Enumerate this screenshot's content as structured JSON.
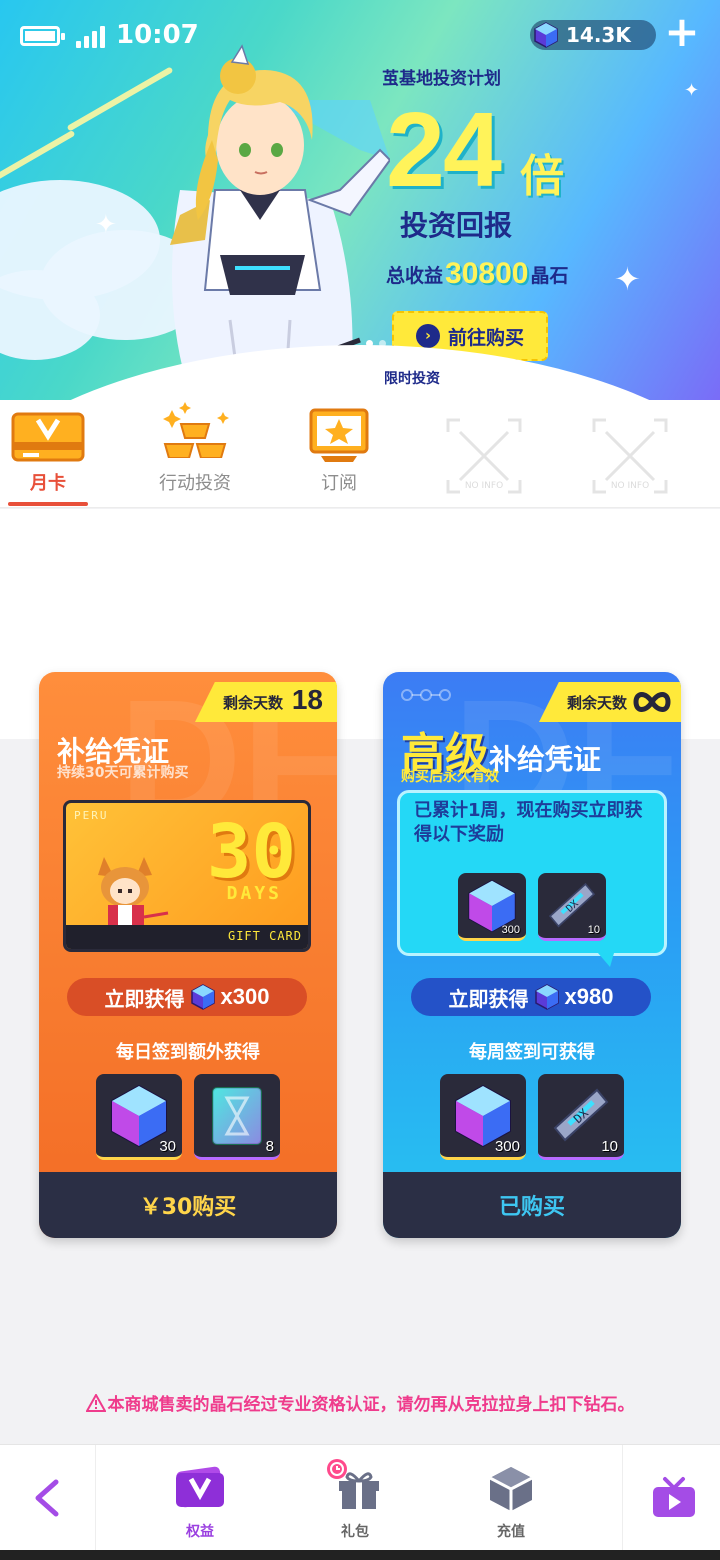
{
  "status": {
    "time": "10:07",
    "gem_amount": "14.3K"
  },
  "promo": {
    "title": "茧基地投资计划",
    "multiplier": "24",
    "multiplier_unit": "倍",
    "subtitle": "投资回报",
    "total_prefix": "总收益",
    "total_value": "30800",
    "total_suffix": "晶石",
    "buy_label": "前往购买",
    "limited_label": "限时投资"
  },
  "tabs": [
    {
      "label": "月卡",
      "active": true
    },
    {
      "label": "行动投资",
      "active": false
    },
    {
      "label": "订阅",
      "active": false
    },
    {
      "label": "NO INFO",
      "active": false
    },
    {
      "label": "NO INFO",
      "active": false
    }
  ],
  "cards": {
    "basic": {
      "tag_label": "剩余天数",
      "tag_value": "18",
      "title": "补给凭证",
      "subtitle": "持续30天可累计购买",
      "giftcard_peru": "PERU",
      "giftcard_days": "30",
      "giftcard_days_label": "DAYS",
      "giftcard_footer": "GIFT CARD",
      "get_now_label": "立即获得",
      "get_now_amount": "x300",
      "daily_label": "每日签到额外获得",
      "items": [
        {
          "icon": "crystal-cube",
          "count": "30"
        },
        {
          "icon": "hourglass-card",
          "count": "8"
        }
      ],
      "footer": "￥30购买"
    },
    "premium": {
      "tag_label": "剩余天数",
      "tag_value": "∞",
      "title_highlight": "高级",
      "title_rest": "补给凭证",
      "subtitle": "购买后永久有效",
      "bubble_text": "已累计1周，现在购买立即获得以下奖励",
      "bubble_items": [
        {
          "icon": "crystal-cube",
          "count": "300"
        },
        {
          "icon": "dx-ticket",
          "count": "10"
        }
      ],
      "get_now_label": "立即获得",
      "get_now_amount": "x980",
      "weekly_label": "每周签到可获得",
      "items": [
        {
          "icon": "crystal-cube",
          "count": "300"
        },
        {
          "icon": "dx-ticket",
          "count": "10"
        }
      ],
      "footer": "已购买"
    }
  },
  "warning": "本商城售卖的晶石经过专业资格认证，请勿再从克拉拉身上扣下钻石。",
  "bottom_nav": [
    {
      "label": "权益",
      "icon": "v-card-icon",
      "active": true
    },
    {
      "label": "礼包",
      "icon": "gift-box-icon",
      "active": false
    },
    {
      "label": "充值",
      "icon": "recharge-cube-icon",
      "active": false
    }
  ],
  "colors": {
    "accent_orange": "#e8503a",
    "accent_purple": "#9a3fe0",
    "gold": "#ffe93a",
    "warning_pink": "#ef3b8c"
  }
}
